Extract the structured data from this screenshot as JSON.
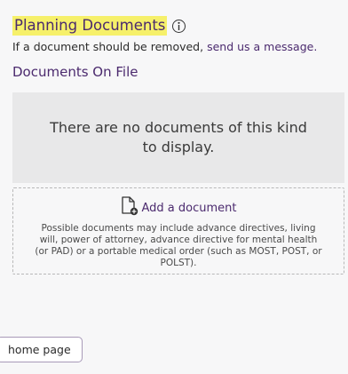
{
  "section": {
    "title": "Planning Documents",
    "highlight_color": "#f6f06a",
    "info_icon": "info-icon"
  },
  "notice": {
    "text": "If a document should be removed,",
    "link": "send us a message."
  },
  "documents": {
    "heading": "Documents On File",
    "empty_message": "There are no documents of this kind to display."
  },
  "add": {
    "icon": "file-add-icon",
    "label": "Add a document",
    "hint": "Possible documents may include advance directives, living will, power of attorney, advance directive for mental health (or PAD) or a portable medical order (such as MOST, POST, or POLST)."
  },
  "nav": {
    "home_button": "home page"
  },
  "colors": {
    "accent": "#4b2a6e",
    "panel": "#e8e8e9"
  }
}
